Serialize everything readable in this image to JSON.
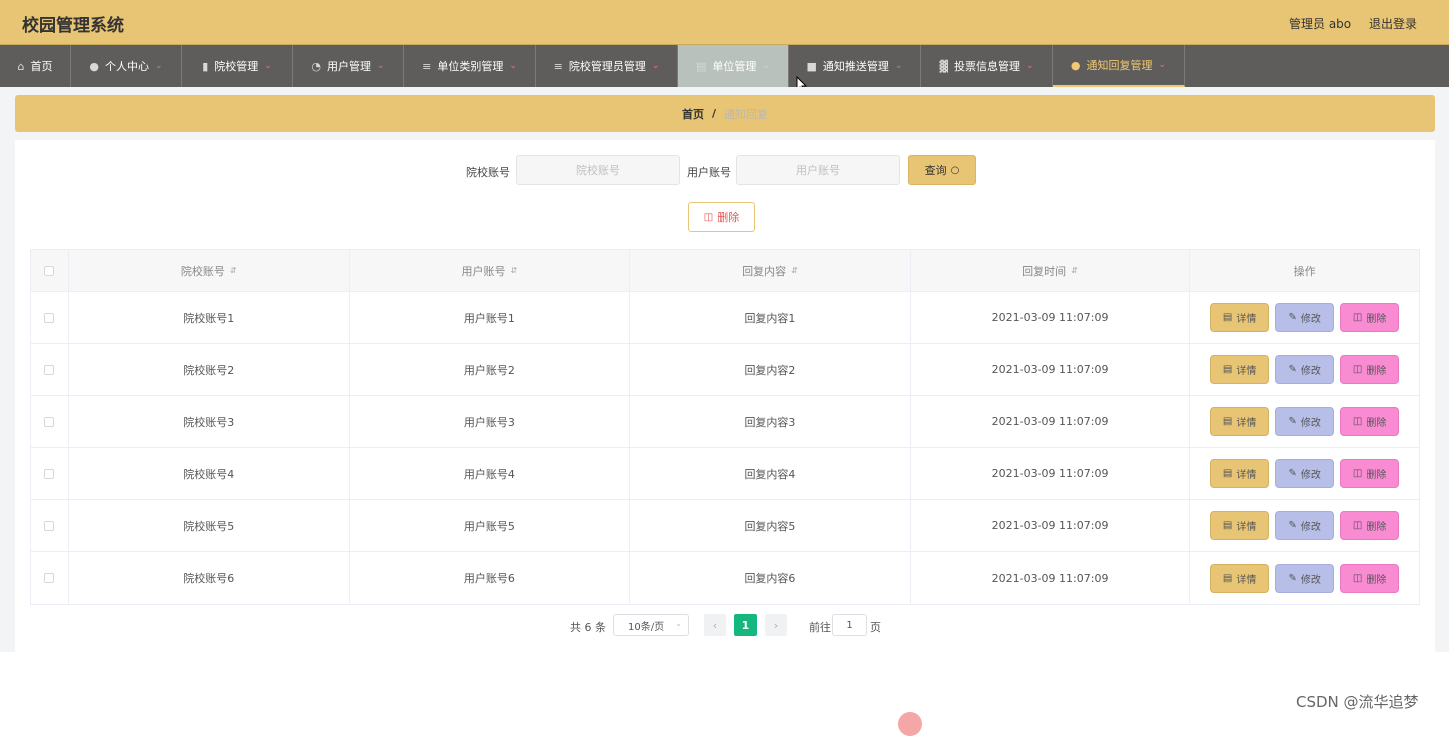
{
  "app": {
    "title": "校园管理系统",
    "user_label": "管理员 abo",
    "logout_label": "退出登录"
  },
  "nav": {
    "items": [
      {
        "label": "首页",
        "icon": "home-icon",
        "caret": false
      },
      {
        "label": "个人中心",
        "icon": "user-icon",
        "caret": true
      },
      {
        "label": "院校管理",
        "icon": "school-icon",
        "caret": true
      },
      {
        "label": "用户管理",
        "icon": "dashboard-icon",
        "caret": true
      },
      {
        "label": "单位类别管理",
        "icon": "menu-icon",
        "caret": true
      },
      {
        "label": "院校管理员管理",
        "icon": "menu-icon",
        "caret": true
      },
      {
        "label": "单位管理",
        "icon": "document-icon",
        "caret": true
      },
      {
        "label": "通知推送管理",
        "icon": "briefcase-icon",
        "caret": true
      },
      {
        "label": "投票信息管理",
        "icon": "chart-icon",
        "caret": true
      },
      {
        "label": "通知回复管理",
        "icon": "user-icon",
        "caret": true
      }
    ]
  },
  "breadcrumb": {
    "home": "首页",
    "separator": "/",
    "current": "通知回复"
  },
  "search": {
    "school_label": "院校账号",
    "school_placeholder": "院校账号",
    "user_label": "用户账号",
    "user_placeholder": "用户账号",
    "query_label": "查询"
  },
  "toolbar": {
    "delete_label": "删除"
  },
  "table": {
    "headers": {
      "school": "院校账号",
      "user": "用户账号",
      "content": "回复内容",
      "time": "回复时间",
      "actions": "操作"
    },
    "rows": [
      {
        "school": "院校账号1",
        "user": "用户账号1",
        "content": "回复内容1",
        "time": "2021-03-09 11:07:09"
      },
      {
        "school": "院校账号2",
        "user": "用户账号2",
        "content": "回复内容2",
        "time": "2021-03-09 11:07:09"
      },
      {
        "school": "院校账号3",
        "user": "用户账号3",
        "content": "回复内容3",
        "time": "2021-03-09 11:07:09"
      },
      {
        "school": "院校账号4",
        "user": "用户账号4",
        "content": "回复内容4",
        "time": "2021-03-09 11:07:09"
      },
      {
        "school": "院校账号5",
        "user": "用户账号5",
        "content": "回复内容5",
        "time": "2021-03-09 11:07:09"
      },
      {
        "school": "院校账号6",
        "user": "用户账号6",
        "content": "回复内容6",
        "time": "2021-03-09 11:07:09"
      }
    ],
    "action_labels": {
      "detail": "详情",
      "edit": "修改",
      "remove": "删除"
    }
  },
  "pagination": {
    "total_text": "共 6 条",
    "page_size": "10条/页",
    "current_page": "1",
    "goto_label": "前往",
    "goto_value": "1",
    "page_word": "页"
  },
  "watermark": "CSDN @流华追梦",
  "colors": {
    "header_bg": "#e8c574",
    "nav_bg": "#5f5d5b",
    "nav_active_bg": "#b9c1bd",
    "detail_btn": "#e8c574",
    "edit_btn": "#b7bfe9",
    "delete_btn": "#f98bd3",
    "pager_active": "#14b87e"
  }
}
